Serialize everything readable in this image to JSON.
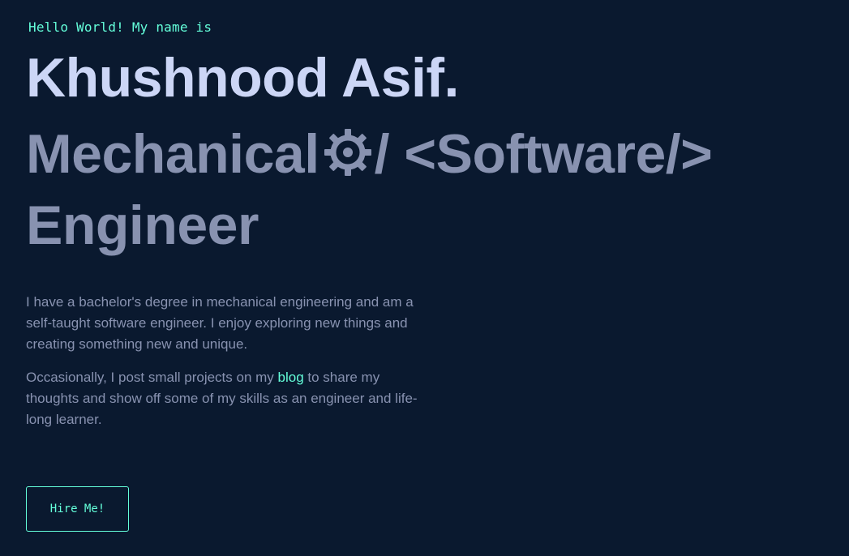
{
  "hero": {
    "greeting": "Hello World! My name is",
    "name": "Khushnood Asif.",
    "role_part1": "Mechanical",
    "role_gear_icon": "gear-icon",
    "role_part2": "/ <Software/>",
    "role_line2": "Engineer",
    "bio_paragraph1": "I have a bachelor's degree in mechanical engineering and am a self-taught software engineer. I enjoy exploring new things and creating something new and unique.",
    "bio_paragraph2_before": "Occasionally, I post small projects on my ",
    "bio_paragraph2_link": "blog",
    "bio_paragraph2_after": " to share my thoughts and show off some of my skills as an engineer and life-long learner.",
    "hire_button": "Hire Me!"
  },
  "colors": {
    "background": "#0a192f",
    "accent": "#64ffda",
    "heading": "#ccd6f6",
    "text": "#8892b0"
  }
}
